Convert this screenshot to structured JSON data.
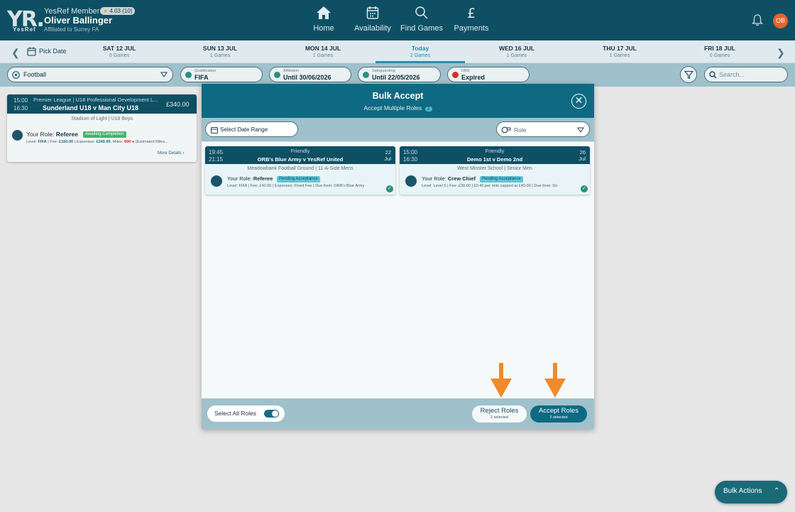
{
  "header": {
    "logo_text": "YR.",
    "logo_sub": "YesRef",
    "member_label": "YesRef Member:",
    "rating": "4.03",
    "rating_count": "(10)",
    "user_name": "Oliver Ballinger",
    "affiliation": "Affiliated to Surrey FA",
    "avatar_initials": "OB",
    "nav": [
      {
        "label": "Home",
        "icon": "home-icon"
      },
      {
        "label": "Availability",
        "icon": "calendar-icon"
      },
      {
        "label": "Find Games",
        "icon": "search-icon"
      },
      {
        "label": "Payments",
        "icon": "pound-icon"
      }
    ]
  },
  "datebar": {
    "pick_date": "Pick Date",
    "days": [
      {
        "day": "SAT 12 JUL",
        "games": "0 Games"
      },
      {
        "day": "SUN 13 JUL",
        "games": "1 Games"
      },
      {
        "day": "MON 14 JUL",
        "games": "1 Games"
      },
      {
        "day": "Today",
        "games": "2 Games"
      },
      {
        "day": "WED 16 JUL",
        "games": "1 Games"
      },
      {
        "day": "THU 17 JUL",
        "games": "1 Games"
      },
      {
        "day": "FRI 18 JUL",
        "games": "0 Games"
      }
    ]
  },
  "filters": {
    "sport": "Football",
    "qualification_label": "Qualification",
    "qualification": "FIFA",
    "affiliation_label": "Affiliation",
    "affiliation": "Until 30/06/2026",
    "safeguarding_label": "Safeguarding",
    "safeguarding": "Until 22/05/2026",
    "dbs_label": "DBS",
    "dbs": "Expired",
    "search_placeholder": "Search..."
  },
  "bg_card": {
    "time_start": "15:00",
    "time_end": "16:30",
    "competition": "Premier League | U18 Professional Development L...",
    "teams": "Sunderland U18  v  Man City U18",
    "fee": "£340.00",
    "venue": "Stadium of Light | U18 Boys",
    "role_label": "Your Role:",
    "role": "Referee",
    "status": "Awaiting Completion",
    "meta_level_label": "Level:",
    "meta_level": "FIFA",
    "meta_fee_label": "| Fee:",
    "meta_fee": "£100.00",
    "meta_exp_label": "| Expenses:",
    "meta_exp": "£240.00",
    "meta_miles_label": ", Miles:",
    "meta_miles": "600",
    "meta_est": "(Estimated Miles...",
    "more": "More Details"
  },
  "modal": {
    "title": "Bulk Accept",
    "subtitle": "Accept Multiple Roles",
    "count": "2",
    "date_range": "Select Date Range",
    "role_placeholder": "Role",
    "cards": [
      {
        "time_start": "19:45",
        "time_end": "21:15",
        "type": "Friendly",
        "teams": "ORB's Blue Army  v  YesRef United",
        "date_day": "22",
        "date_month": "Jul",
        "venue": "Meadowbank Football Ground | 11-A-Side Mens",
        "role_label": "Your Role:",
        "role": "Referee",
        "status": "Pending Acceptance",
        "meta": "Level: FIFA | Fee: £40.00 | Expenses: Fixed Fee | Due from: ORB's Blue Army"
      },
      {
        "time_start": "15:00",
        "time_end": "16:30",
        "type": "Friendly",
        "teams": "Demo 1st  v  Demo 2nd",
        "date_day": "26",
        "date_month": "Jul",
        "venue": "West Minster School | Senior Men",
        "role_label": "Your Role:",
        "role": "Crew Chief",
        "status": "Pending Acceptance",
        "meta": "Level: Level 5 | Fee: £30.00 | £0.40 per mile capped at £40.00 | Due from: De"
      }
    ],
    "select_all": "Select All Roles",
    "select_all_on": true,
    "reject_label": "Reject Roles",
    "reject_sub": "2 selected",
    "accept_label": "Accept Roles",
    "accept_sub": "2 selected"
  },
  "bulk_actions": "Bulk Actions",
  "colors": {
    "header": "#0e4f64",
    "accent": "#0e6a82",
    "arrow": "#f08a2c",
    "avatar": "#e86330"
  }
}
